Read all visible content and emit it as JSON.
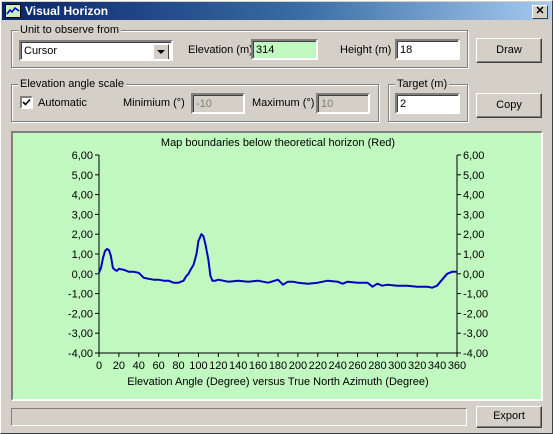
{
  "window": {
    "title": "Visual Horizon",
    "close_glyph": "✕",
    "icon": "chart-icon"
  },
  "observe": {
    "legend": "Unit to observe from",
    "unit_value": "Cursor",
    "elevation_label": "Elevation (m)",
    "elevation_value": "314",
    "height_label": "Height (m)",
    "height_value": "18"
  },
  "scale": {
    "legend": "Elevation angle scale",
    "automatic_label": "Automatic",
    "automatic_checked": true,
    "min_label": "Minimium (°)",
    "min_value": "-10",
    "max_label": "Maximum (°)",
    "max_value": "10"
  },
  "target": {
    "legend": "Target (m)",
    "value": "2"
  },
  "buttons": {
    "draw": "Draw",
    "copy": "Copy",
    "export": "Export"
  },
  "colors": {
    "plot_bg": "#c0f8c0",
    "line": "#0000c0",
    "below_horizon": "#ff0000"
  },
  "chart_data": {
    "type": "line",
    "title": "Map boundaries below theoretical horizon (Red)",
    "xlabel": "Elevation Angle (Degree) versus True North Azimuth (Degree)",
    "ylabel": "",
    "xlim": [
      0,
      360
    ],
    "ylim": [
      -4,
      6
    ],
    "x_ticks": [
      "0",
      "20",
      "40",
      "60",
      "80",
      "100",
      "120",
      "140",
      "160",
      "180",
      "200",
      "220",
      "240",
      "260",
      "280",
      "300",
      "320",
      "340",
      "360"
    ],
    "y_ticks": [
      "6,00",
      "5,00",
      "4,00",
      "3,00",
      "2,00",
      "1,00",
      "0,00",
      "-1,00",
      "-2,00",
      "-3,00",
      "-4,00"
    ],
    "grid": false,
    "series": [
      {
        "color": "#0000c0",
        "x": [
          0,
          2,
          4,
          6,
          8,
          10,
          12,
          14,
          16,
          18,
          20,
          25,
          30,
          35,
          40,
          45,
          50,
          55,
          60,
          65,
          70,
          75,
          80,
          85,
          88,
          90,
          92,
          95,
          98,
          100,
          103,
          105,
          107,
          110,
          112,
          114,
          117,
          120,
          125,
          130,
          140,
          150,
          160,
          170,
          180,
          185,
          190,
          195,
          200,
          210,
          220,
          230,
          240,
          245,
          250,
          260,
          270,
          275,
          280,
          285,
          290,
          300,
          310,
          320,
          330,
          335,
          340,
          345,
          350,
          355,
          360
        ],
        "y": [
          0.05,
          0.3,
          0.8,
          1.15,
          1.25,
          1.2,
          0.9,
          0.3,
          0.2,
          0.15,
          0.25,
          0.2,
          0.1,
          0.1,
          0.05,
          -0.2,
          -0.25,
          -0.3,
          -0.3,
          -0.35,
          -0.35,
          -0.45,
          -0.45,
          -0.35,
          -0.1,
          0,
          0.2,
          0.45,
          1.0,
          1.65,
          2.0,
          1.9,
          1.5,
          0.7,
          -0.1,
          -0.35,
          -0.35,
          -0.3,
          -0.35,
          -0.4,
          -0.35,
          -0.4,
          -0.35,
          -0.45,
          -0.3,
          -0.55,
          -0.4,
          -0.4,
          -0.45,
          -0.5,
          -0.45,
          -0.35,
          -0.4,
          -0.5,
          -0.4,
          -0.45,
          -0.45,
          -0.65,
          -0.5,
          -0.6,
          -0.55,
          -0.6,
          -0.6,
          -0.65,
          -0.65,
          -0.7,
          -0.6,
          -0.3,
          0,
          0.1,
          0.1
        ]
      }
    ]
  }
}
